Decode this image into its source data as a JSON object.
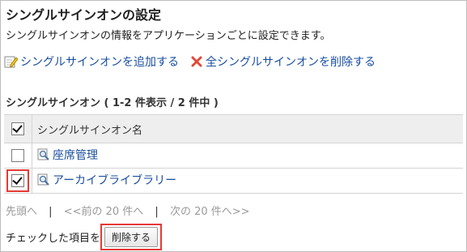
{
  "page": {
    "title": "シングルサインオンの設定",
    "description": "シングルサインオンの情報をアプリケーションごとに設定できます。"
  },
  "actions": {
    "add_label": "シングルサインオンを追加する",
    "delete_all_label": "全シングルサインオンを削除する"
  },
  "list": {
    "section_title": "シングルサインオン ( 1-2 件表示 / 2 件中 )",
    "header_name": "シングルサインオン名",
    "header_checked": true,
    "rows": [
      {
        "name": "座席管理",
        "checked": false
      },
      {
        "name": "アーカイブライブラリー",
        "checked": true
      }
    ]
  },
  "pager": {
    "first": "先頭へ",
    "prev": "<<前の 20 件へ",
    "next": "次の 20 件へ>>",
    "separator": "|"
  },
  "bulk": {
    "label": "チェックした項目を",
    "delete_button": "削除する"
  },
  "colors": {
    "link": "#1a4fa0",
    "highlight": "#e53935"
  },
  "icons": [
    "pencil-icon",
    "delete-x-icon",
    "magnifier-icon",
    "checkbox-icon"
  ]
}
